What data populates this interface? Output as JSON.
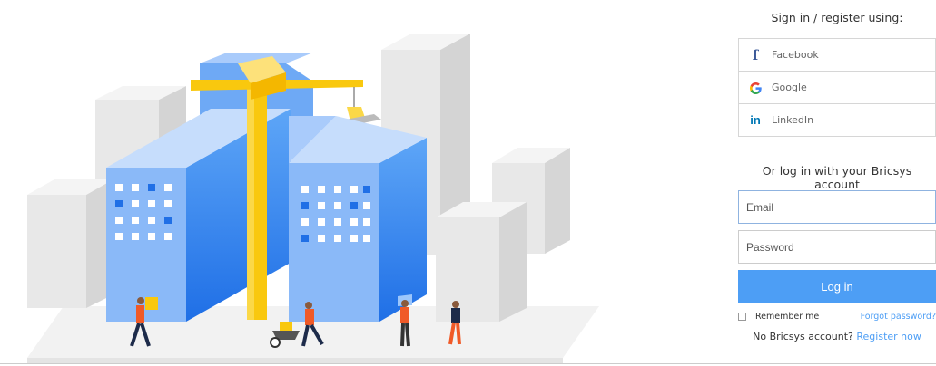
{
  "signin_heading": "Sign in / register using:",
  "social": [
    {
      "icon": "f",
      "label": "Facebook",
      "icon_name": "facebook-icon"
    },
    {
      "icon": "G",
      "label": "Google",
      "icon_name": "google-icon"
    },
    {
      "icon": "in",
      "label": "LinkedIn",
      "icon_name": "linkedin-icon"
    }
  ],
  "account_heading": "Or log in with your Bricsys account",
  "form": {
    "email_placeholder": "Email",
    "password_placeholder": "Password",
    "login_label": "Log in",
    "remember_label": "Remember me",
    "forgot_label": "Forgot password?",
    "no_account_text": "No Bricsys account?",
    "register_label": "Register now"
  },
  "colors": {
    "primary": "#4d9ef5",
    "building_blue": "#3b8cf2",
    "building_light": "#bcd8fb",
    "crane_yellow": "#f9c80e",
    "grey_block": "#e5e5e5"
  }
}
